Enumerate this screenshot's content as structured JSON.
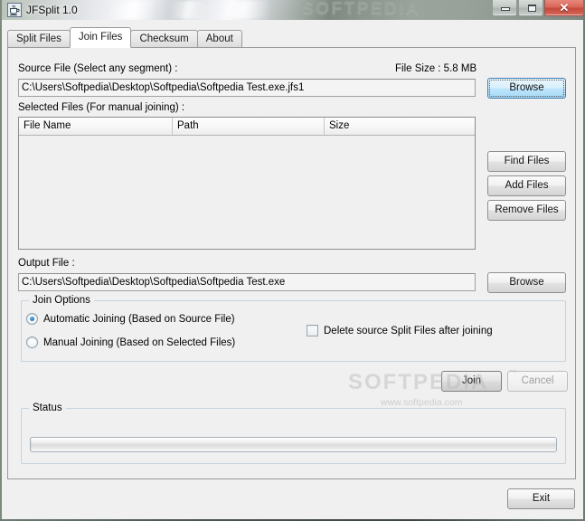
{
  "window": {
    "title": "JFSplit 1.0",
    "icon": "java-coffee-cup-icon",
    "watermark_title": "SOFTPEDIA",
    "controls": {
      "minimize_label": "",
      "maximize_label": "",
      "close_label": "✕"
    }
  },
  "tabs": [
    {
      "label": "Split Files",
      "selected": false
    },
    {
      "label": "Join Files",
      "selected": true
    },
    {
      "label": "Checksum",
      "selected": false
    },
    {
      "label": "About",
      "selected": false
    }
  ],
  "join_panel": {
    "source_file": {
      "label": "Source File (Select any segment) :",
      "value": "C:\\Users\\Softpedia\\Desktop\\Softpedia\\Softpedia Test.exe.jfs1",
      "placeholder": "",
      "browse_label": "Browse"
    },
    "file_size": {
      "label": "File Size :",
      "value": "5.8 MB",
      "full": "File Size : 5.8 MB"
    },
    "selected_files": {
      "label": "Selected Files (For manual joining) :",
      "columns": [
        "File Name",
        "Path",
        "Size"
      ],
      "rows": [],
      "buttons": [
        {
          "label": "Find Files"
        },
        {
          "label": "Add Files"
        },
        {
          "label": "Remove Files"
        }
      ]
    },
    "output_file": {
      "label": "Output File :",
      "value": "C:\\Users\\Softpedia\\Desktop\\Softpedia\\Softpedia Test.exe",
      "placeholder": "",
      "browse_label": "Browse"
    },
    "join_options": {
      "title": "Join Options",
      "radios": [
        {
          "label": "Automatic Joining (Based on Source File)",
          "checked": true
        },
        {
          "label": "Manual Joining (Based on Selected Files)",
          "checked": false
        }
      ],
      "checkbox": {
        "label": "Delete source Split Files after joining",
        "checked": false
      }
    },
    "actions": {
      "join_label": "Join",
      "cancel_label": "Cancel",
      "cancel_disabled": true
    },
    "status": {
      "title": "Status",
      "progress_percent": 0,
      "progress_text": ""
    }
  },
  "footer": {
    "exit_label": "Exit"
  },
  "page_watermark": {
    "brand": "SOFTPEDIA",
    "tm": "™",
    "url": "www.softpedia.com"
  },
  "colors": {
    "window_bg": "#f0f0f0",
    "panel_border": "#9a9a9a",
    "focus_accent": "#3c7fb1",
    "radio_accent": "#1d6fb0",
    "close_button": "#c4493c",
    "group_border": "#c6d3de"
  }
}
